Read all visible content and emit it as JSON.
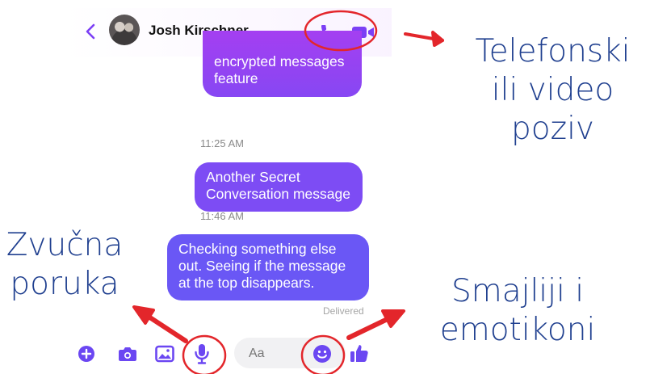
{
  "header": {
    "contact_name": "Josh Kirschner"
  },
  "messages": [
    {
      "text": "encrypted messages feature"
    },
    {
      "time": "11:25 AM",
      "text": "Another Secret Conversation message"
    },
    {
      "time": "11:46 AM",
      "text": "Checking something else out. Seeing if the message at the top disappears.",
      "status": "Delivered"
    }
  ],
  "composer": {
    "placeholder": "Aa"
  },
  "annotations": {
    "call": "Telefonski ili video poziv",
    "voice": "Zvučna poruka",
    "emoji": "Smajliji i emotikoni"
  },
  "colors": {
    "accent": "#7b3ff5",
    "annotation": "#e3262b",
    "annotation_text": "#1f3f8f"
  }
}
